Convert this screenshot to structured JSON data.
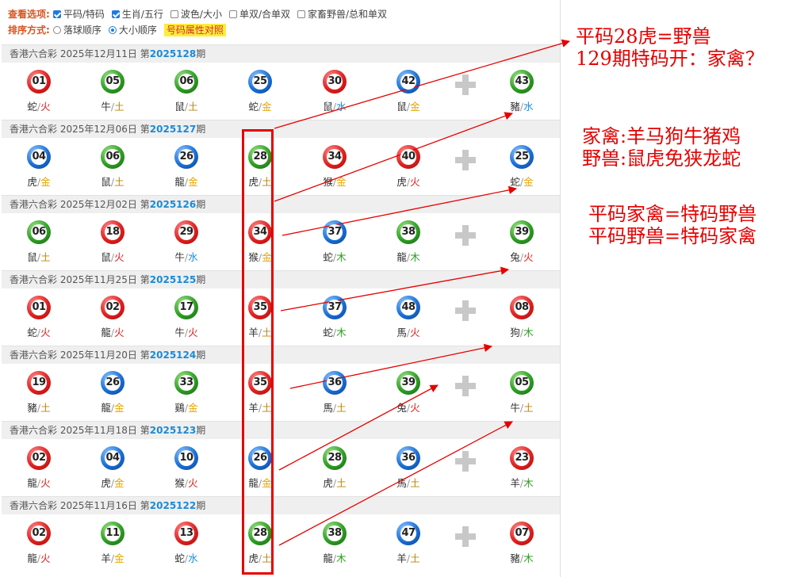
{
  "options": {
    "view_label": "查看选项:",
    "view_items": [
      {
        "label": "平码/特码",
        "checked": true
      },
      {
        "label": "生肖/五行",
        "checked": true
      },
      {
        "label": "波色/大小",
        "checked": false
      },
      {
        "label": "单双/合单双",
        "checked": false
      },
      {
        "label": "家畜野兽/总和单双",
        "checked": false
      }
    ],
    "sort_label": "排序方式:",
    "sort_items": [
      {
        "label": "落球顺序",
        "selected": false
      },
      {
        "label": "大小顺序",
        "selected": true
      }
    ],
    "attr_button": "号码属性对照"
  },
  "colors": {
    "red": "#e02020",
    "blue": "#1a6fd6",
    "green": "#2e9e23",
    "element": {
      "火": "#e02020",
      "土": "#b8860b",
      "金": "#e6a800",
      "水": "#1a8bd6",
      "木": "#2e9e23"
    }
  },
  "draws": [
    {
      "lottery": "香港六合彩",
      "date": "2025年12月11日",
      "prefix": "第",
      "issue": "2025128",
      "suffix": "期",
      "balls": [
        {
          "num": "01",
          "color": "red",
          "zodiac": "蛇",
          "element": "火"
        },
        {
          "num": "05",
          "color": "green",
          "zodiac": "牛",
          "element": "土"
        },
        {
          "num": "06",
          "color": "green",
          "zodiac": "鼠",
          "element": "土"
        },
        {
          "num": "25",
          "color": "blue",
          "zodiac": "蛇",
          "element": "金"
        },
        {
          "num": "30",
          "color": "red",
          "zodiac": "鼠",
          "element": "水"
        },
        {
          "num": "42",
          "color": "blue",
          "zodiac": "鼠",
          "element": "金"
        }
      ],
      "special": {
        "num": "43",
        "color": "green",
        "zodiac": "豬",
        "element": "水"
      }
    },
    {
      "lottery": "香港六合彩",
      "date": "2025年12月06日",
      "prefix": "第",
      "issue": "2025127",
      "suffix": "期",
      "balls": [
        {
          "num": "04",
          "color": "blue",
          "zodiac": "虎",
          "element": "金"
        },
        {
          "num": "06",
          "color": "green",
          "zodiac": "鼠",
          "element": "土"
        },
        {
          "num": "26",
          "color": "blue",
          "zodiac": "龍",
          "element": "金"
        },
        {
          "num": "28",
          "color": "green",
          "zodiac": "虎",
          "element": "土"
        },
        {
          "num": "34",
          "color": "red",
          "zodiac": "猴",
          "element": "金"
        },
        {
          "num": "40",
          "color": "red",
          "zodiac": "虎",
          "element": "火"
        }
      ],
      "special": {
        "num": "25",
        "color": "blue",
        "zodiac": "蛇",
        "element": "金"
      }
    },
    {
      "lottery": "香港六合彩",
      "date": "2025年12月02日",
      "prefix": "第",
      "issue": "2025126",
      "suffix": "期",
      "balls": [
        {
          "num": "06",
          "color": "green",
          "zodiac": "鼠",
          "element": "土"
        },
        {
          "num": "18",
          "color": "red",
          "zodiac": "鼠",
          "element": "火"
        },
        {
          "num": "29",
          "color": "red",
          "zodiac": "牛",
          "element": "水"
        },
        {
          "num": "34",
          "color": "red",
          "zodiac": "猴",
          "element": "金"
        },
        {
          "num": "37",
          "color": "blue",
          "zodiac": "蛇",
          "element": "木"
        },
        {
          "num": "38",
          "color": "green",
          "zodiac": "龍",
          "element": "木"
        }
      ],
      "special": {
        "num": "39",
        "color": "green",
        "zodiac": "兔",
        "element": "火"
      }
    },
    {
      "lottery": "香港六合彩",
      "date": "2025年11月25日",
      "prefix": "第",
      "issue": "2025125",
      "suffix": "期",
      "balls": [
        {
          "num": "01",
          "color": "red",
          "zodiac": "蛇",
          "element": "火"
        },
        {
          "num": "02",
          "color": "red",
          "zodiac": "龍",
          "element": "火"
        },
        {
          "num": "17",
          "color": "green",
          "zodiac": "牛",
          "element": "火"
        },
        {
          "num": "35",
          "color": "red",
          "zodiac": "羊",
          "element": "土"
        },
        {
          "num": "37",
          "color": "blue",
          "zodiac": "蛇",
          "element": "木"
        },
        {
          "num": "48",
          "color": "blue",
          "zodiac": "馬",
          "element": "火"
        }
      ],
      "special": {
        "num": "08",
        "color": "red",
        "zodiac": "狗",
        "element": "木"
      }
    },
    {
      "lottery": "香港六合彩",
      "date": "2025年11月20日",
      "prefix": "第",
      "issue": "2025124",
      "suffix": "期",
      "balls": [
        {
          "num": "19",
          "color": "red",
          "zodiac": "豬",
          "element": "土"
        },
        {
          "num": "26",
          "color": "blue",
          "zodiac": "龍",
          "element": "金"
        },
        {
          "num": "33",
          "color": "green",
          "zodiac": "鷄",
          "element": "金"
        },
        {
          "num": "35",
          "color": "red",
          "zodiac": "羊",
          "element": "土"
        },
        {
          "num": "36",
          "color": "blue",
          "zodiac": "馬",
          "element": "土"
        },
        {
          "num": "39",
          "color": "green",
          "zodiac": "兔",
          "element": "火"
        }
      ],
      "special": {
        "num": "05",
        "color": "green",
        "zodiac": "牛",
        "element": "土"
      }
    },
    {
      "lottery": "香港六合彩",
      "date": "2025年11月18日",
      "prefix": "第",
      "issue": "2025123",
      "suffix": "期",
      "balls": [
        {
          "num": "02",
          "color": "red",
          "zodiac": "龍",
          "element": "火"
        },
        {
          "num": "04",
          "color": "blue",
          "zodiac": "虎",
          "element": "金"
        },
        {
          "num": "10",
          "color": "blue",
          "zodiac": "猴",
          "element": "火"
        },
        {
          "num": "26",
          "color": "blue",
          "zodiac": "龍",
          "element": "金"
        },
        {
          "num": "28",
          "color": "green",
          "zodiac": "虎",
          "element": "土"
        },
        {
          "num": "36",
          "color": "blue",
          "zodiac": "馬",
          "element": "土"
        }
      ],
      "special": {
        "num": "23",
        "color": "red",
        "zodiac": "羊",
        "element": "木"
      }
    },
    {
      "lottery": "香港六合彩",
      "date": "2025年11月16日",
      "prefix": "第",
      "issue": "2025122",
      "suffix": "期",
      "balls": [
        {
          "num": "02",
          "color": "red",
          "zodiac": "龍",
          "element": "火"
        },
        {
          "num": "11",
          "color": "green",
          "zodiac": "羊",
          "element": "金"
        },
        {
          "num": "13",
          "color": "red",
          "zodiac": "蛇",
          "element": "水"
        },
        {
          "num": "28",
          "color": "green",
          "zodiac": "虎",
          "element": "土"
        },
        {
          "num": "38",
          "color": "green",
          "zodiac": "龍",
          "element": "木"
        },
        {
          "num": "47",
          "color": "blue",
          "zodiac": "羊",
          "element": "土"
        }
      ],
      "special": {
        "num": "07",
        "color": "red",
        "zodiac": "豬",
        "element": "木"
      }
    }
  ],
  "annotations": {
    "title_line1": "平码28虎=野兽",
    "title_line2": "129期特码开：家禽？",
    "domestic": "家禽:羊马狗牛猪鸡",
    "wild": "野兽:鼠虎免狭龙蛇",
    "rule1": "平码家禽=特码野兽",
    "rule2": "平码野兽=特码家禽"
  }
}
